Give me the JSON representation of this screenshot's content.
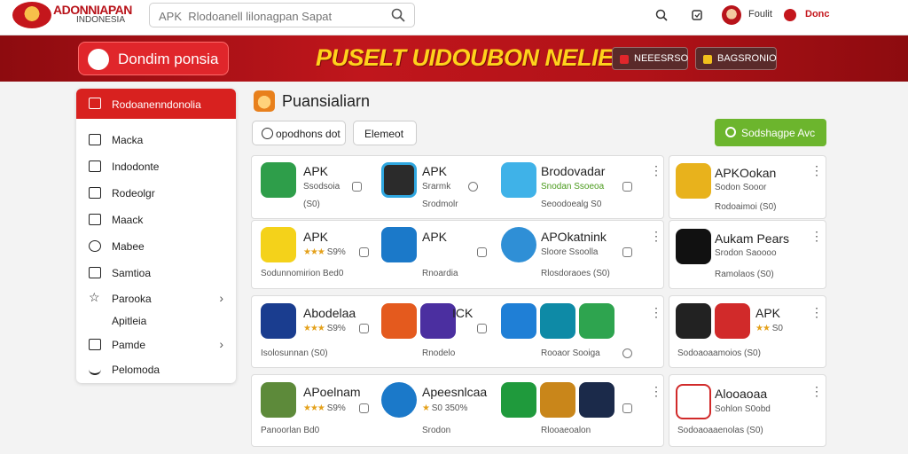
{
  "header": {
    "logo_title": "ADONNIAPAN",
    "logo_subtitle": "INDONESIA",
    "search_placeholder": "APK  Rlodoanell lilonagpan Sapat",
    "profile_label": "Foulit",
    "action_label": "Donc"
  },
  "banner": {
    "button_label": "Dondim ponsia",
    "title": "PUSELT UIDOUBON NELIEN",
    "chip1_label": "NEEESRSO",
    "chip2_label": "BAGSRONIO"
  },
  "sidebar": {
    "items": [
      {
        "label": "Rodoanenndonolia"
      },
      {
        "label": "Macka"
      },
      {
        "label": "Indodonte"
      },
      {
        "label": "Rodeolgr"
      },
      {
        "label": "Maack"
      },
      {
        "label": "Mabee"
      },
      {
        "label": "Samtioa"
      },
      {
        "label": "Parooka"
      },
      {
        "label": "Apitleia"
      },
      {
        "label": "Pamde"
      },
      {
        "label": "Pelomoda"
      }
    ]
  },
  "main": {
    "section_title": "Puansialiarn",
    "filter1_label": "opodhons dot",
    "filter2_label": "Elemeot",
    "green_button_label": "Sodshagpe Avc"
  },
  "cards": [
    {
      "name": "APK",
      "meta": "Ssodsoia",
      "foot": "(S0)"
    },
    {
      "name": "APK",
      "meta": "Srarmk",
      "foot": "Srodmolr"
    },
    {
      "name": "Brodovadar",
      "meta": "Snodan  Ssoeoa",
      "foot": "Seoodoealg  S0"
    },
    {
      "name": "APKOokan",
      "meta": "Sodon  Sooor",
      "foot": "Rodoaimoi (S0)"
    },
    {
      "name": "APK",
      "meta": "S9%",
      "foot": "Sodunnomirion Bed0"
    },
    {
      "name": "APK",
      "meta": "",
      "foot": "Rnoardia"
    },
    {
      "name": "APOkatnink",
      "meta": "Sloore  Ssoolla",
      "foot": "Rlosdoraoes (S0)"
    },
    {
      "name": "Aukam Pears",
      "meta": "Srodon  Saoooo",
      "foot": "Ramolaos (S0)"
    },
    {
      "name": "Abodelaa",
      "meta": "S9%",
      "foot": "Isolosunnan (S0)"
    },
    {
      "name": "ICK",
      "meta": "",
      "foot": "Rnodelo"
    },
    {
      "name": "",
      "meta": "",
      "foot": "Rooaor Sooiga"
    },
    {
      "name": "APK",
      "meta": "S0",
      "foot": "Sodoaoaamoios (S0)"
    },
    {
      "name": "APoelnam",
      "meta": "S9%",
      "foot": "Panoorlan Bd0"
    },
    {
      "name": "Apeesnlcaa",
      "meta": "S0 350%",
      "foot": "Srodon"
    },
    {
      "name": "",
      "meta": "",
      "foot": "Rlooaeoalon"
    },
    {
      "name": "Alooaoaa",
      "meta": "Sohlon  S0obd",
      "foot": "Sodoaoaaenolas (S0)"
    }
  ],
  "colors": {
    "brand_red": "#c4161c",
    "banner_yellow": "#ffd21c",
    "accent_green": "#6cb52d"
  },
  "icons": {
    "search": "search-icon",
    "refresh": "refresh-icon",
    "menu": "kebab-menu-icon"
  }
}
